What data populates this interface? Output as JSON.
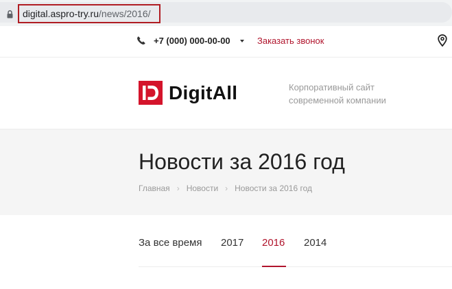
{
  "browser": {
    "url_host": "digital.aspro-try.ru",
    "url_path": "/news/2016/"
  },
  "topbar": {
    "phone": "+7 (000) 000-00-00",
    "callback_label": "Заказать звонок"
  },
  "header": {
    "logo_text": "DigitAll",
    "slogan_line1": "Корпоративный сайт",
    "slogan_line2": "современной компании"
  },
  "page": {
    "title": "Новости за 2016 год",
    "breadcrumbs": [
      "Главная",
      "Новости",
      "Новости за 2016 год"
    ]
  },
  "tabs": [
    {
      "label": "За все время"
    },
    {
      "label": "2017"
    },
    {
      "label": "2016",
      "active": true
    },
    {
      "label": "2014"
    }
  ],
  "colors": {
    "accent": "#b0142c",
    "logo_red": "#d4142b",
    "url_highlight": "#b01c22"
  },
  "icons": {
    "lock": "lock-icon",
    "phone": "phone-icon",
    "caret": "caret-down-icon",
    "location": "map-pin-icon",
    "logo": "digitall-logo-icon"
  }
}
